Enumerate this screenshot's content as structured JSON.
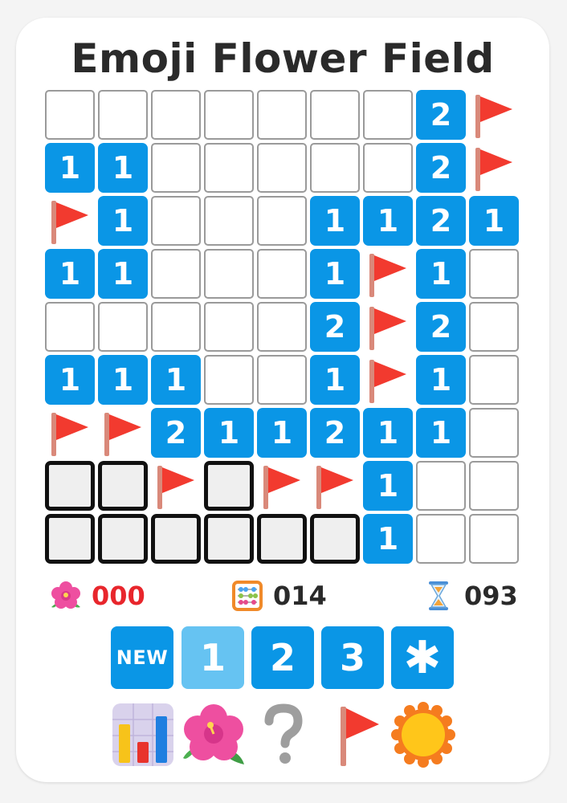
{
  "title": "Emoji Flower Field",
  "board": {
    "rows": 9,
    "cols": 9,
    "cells": [
      [
        "h",
        "h",
        "h",
        "h",
        "h",
        "h",
        "h",
        "2",
        "F"
      ],
      [
        "1",
        "1",
        "h",
        "h",
        "h",
        "h",
        "h",
        "2",
        "F"
      ],
      [
        "F",
        "1",
        "h",
        "h",
        "h",
        "1",
        "1",
        "2",
        "1"
      ],
      [
        "1",
        "1",
        "h",
        "h",
        "h",
        "1",
        "F",
        "1",
        "h"
      ],
      [
        "h",
        "h",
        "h",
        "h",
        "h",
        "2",
        "F",
        "2",
        "h"
      ],
      [
        "1",
        "1",
        "1",
        "h",
        "h",
        "1",
        "F",
        "1",
        "h"
      ],
      [
        "F",
        "F",
        "2",
        "1",
        "1",
        "2",
        "1",
        "1",
        "h"
      ],
      [
        "S",
        "S",
        "F",
        "S",
        "F",
        "F",
        "1",
        "h",
        "h"
      ],
      [
        "S",
        "S",
        "S",
        "S",
        "S",
        "S",
        "1",
        "h",
        "h"
      ]
    ]
  },
  "status": {
    "flowers_found": "000",
    "remaining": "014",
    "time": "093"
  },
  "levels": {
    "new_label": "NEW",
    "level1": "1",
    "level2": "2",
    "level3": "3",
    "custom": "✱",
    "active_level": 1
  },
  "tools": [
    "stats-icon",
    "flower-icon",
    "help-icon",
    "flag-icon",
    "sun-icon"
  ],
  "colors": {
    "number_tile": "#0a96e6",
    "active_level": "#66c3f2",
    "counter_red": "#e8262c",
    "flag_red": "#f23a2f",
    "flag_pole": "#d9897a"
  }
}
